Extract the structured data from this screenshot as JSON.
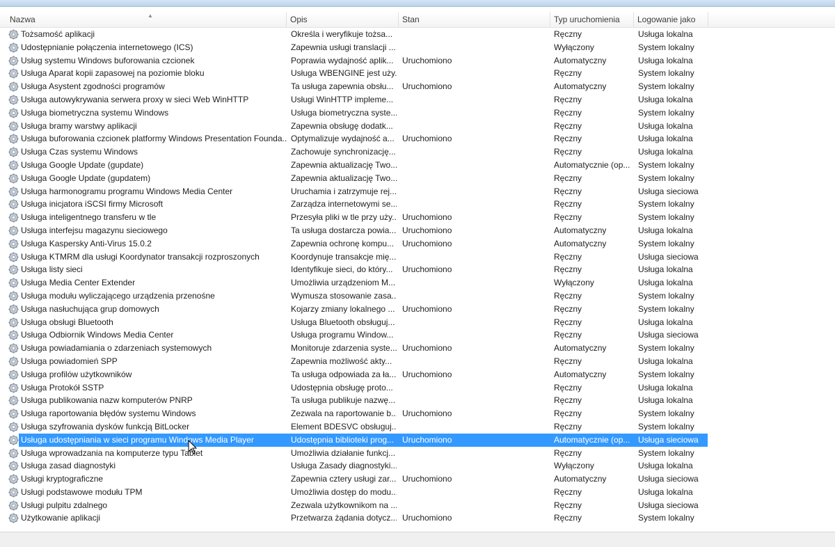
{
  "columns": {
    "name": "Nazwa",
    "desc": "Opis",
    "state": "Stan",
    "type": "Typ uruchomienia",
    "logon": "Logowanie jako"
  },
  "sort_indicator": "▲",
  "selected_index": 31,
  "rows": [
    {
      "name": "Tożsamość aplikacji",
      "desc": "Określa i weryfikuje tożsa...",
      "state": "",
      "type": "Ręczny",
      "logon": "Usługa lokalna"
    },
    {
      "name": "Udostępnianie połączenia internetowego (ICS)",
      "desc": "Zapewnia usługi translacji ...",
      "state": "",
      "type": "Wyłączony",
      "logon": "System lokalny"
    },
    {
      "name": "Usług systemu Windows buforowania czcionek",
      "desc": "Poprawia wydajność aplik...",
      "state": "Uruchomiono",
      "type": "Automatyczny",
      "logon": "Usługa lokalna"
    },
    {
      "name": "Usługa Aparat kopii zapasowej na poziomie bloku",
      "desc": "Usługa WBENGINE jest uży...",
      "state": "",
      "type": "Ręczny",
      "logon": "System lokalny"
    },
    {
      "name": "Usługa Asystent zgodności programów",
      "desc": "Ta usługa zapewnia obsłu...",
      "state": "Uruchomiono",
      "type": "Automatyczny",
      "logon": "System lokalny"
    },
    {
      "name": "Usługa autowykrywania serwera proxy w sieci Web WinHTTP",
      "desc": "Usługi WinHTTP impleme...",
      "state": "",
      "type": "Ręczny",
      "logon": "Usługa lokalna"
    },
    {
      "name": "Usługa biometryczna systemu Windows",
      "desc": "Usługa biometryczna syste...",
      "state": "",
      "type": "Ręczny",
      "logon": "System lokalny"
    },
    {
      "name": "Usługa bramy warstwy aplikacji",
      "desc": "Zapewnia obsługę dodatk...",
      "state": "",
      "type": "Ręczny",
      "logon": "Usługa lokalna"
    },
    {
      "name": "Usługa buforowania czcionek platformy Windows Presentation Founda...",
      "desc": "Optymalizuje wydajność a...",
      "state": "Uruchomiono",
      "type": "Ręczny",
      "logon": "Usługa lokalna"
    },
    {
      "name": "Usługa Czas systemu Windows",
      "desc": "Zachowuje synchronizację...",
      "state": "",
      "type": "Ręczny",
      "logon": "Usługa lokalna"
    },
    {
      "name": "Usługa Google Update (gupdate)",
      "desc": "Zapewnia aktualizację Two...",
      "state": "",
      "type": "Automatycznie (op...",
      "logon": "System lokalny"
    },
    {
      "name": "Usługa Google Update (gupdatem)",
      "desc": "Zapewnia aktualizację Two...",
      "state": "",
      "type": "Ręczny",
      "logon": "System lokalny"
    },
    {
      "name": "Usługa harmonogramu programu Windows Media Center",
      "desc": "Uruchamia i zatrzymuje rej...",
      "state": "",
      "type": "Ręczny",
      "logon": "Usługa sieciowa"
    },
    {
      "name": "Usługa inicjatora iSCSI firmy Microsoft",
      "desc": "Zarządza internetowymi se...",
      "state": "",
      "type": "Ręczny",
      "logon": "System lokalny"
    },
    {
      "name": "Usługa inteligentnego transferu w tle",
      "desc": "Przesyła pliki w tle przy uży...",
      "state": "Uruchomiono",
      "type": "Ręczny",
      "logon": "System lokalny"
    },
    {
      "name": "Usługa interfejsu magazynu sieciowego",
      "desc": "Ta usługa dostarcza powia...",
      "state": "Uruchomiono",
      "type": "Automatyczny",
      "logon": "Usługa lokalna"
    },
    {
      "name": "Usługa Kaspersky Anti-Virus 15.0.2",
      "desc": "Zapewnia ochronę kompu...",
      "state": "Uruchomiono",
      "type": "Automatyczny",
      "logon": "System lokalny"
    },
    {
      "name": "Usługa KTMRM dla usługi Koordynator transakcji rozproszonych",
      "desc": "Koordynuje transakcje mię...",
      "state": "",
      "type": "Ręczny",
      "logon": "Usługa sieciowa"
    },
    {
      "name": "Usługa listy sieci",
      "desc": "Identyfikuje sieci, do który...",
      "state": "Uruchomiono",
      "type": "Ręczny",
      "logon": "Usługa lokalna"
    },
    {
      "name": "Usługa Media Center Extender",
      "desc": "Umożliwia urządzeniom M...",
      "state": "",
      "type": "Wyłączony",
      "logon": "Usługa lokalna"
    },
    {
      "name": "Usługa modułu wyliczającego urządzenia przenośne",
      "desc": "Wymusza stosowanie zasa...",
      "state": "",
      "type": "Ręczny",
      "logon": "System lokalny"
    },
    {
      "name": "Usługa nasłuchująca grup domowych",
      "desc": "Kojarzy zmiany lokalnego ...",
      "state": "Uruchomiono",
      "type": "Ręczny",
      "logon": "System lokalny"
    },
    {
      "name": "Usługa obsługi Bluetooth",
      "desc": "Usługa Bluetooth obsługuj...",
      "state": "",
      "type": "Ręczny",
      "logon": "Usługa lokalna"
    },
    {
      "name": "Usługa Odbiornik Windows Media Center",
      "desc": "Usługa programu Window...",
      "state": "",
      "type": "Ręczny",
      "logon": "Usługa sieciowa"
    },
    {
      "name": "Usługa powiadamiania o zdarzeniach systemowych",
      "desc": "Monitoruje zdarzenia syste...",
      "state": "Uruchomiono",
      "type": "Automatyczny",
      "logon": "System lokalny"
    },
    {
      "name": "Usługa powiadomień SPP",
      "desc": "Zapewnia możliwość akty...",
      "state": "",
      "type": "Ręczny",
      "logon": "Usługa lokalna"
    },
    {
      "name": "Usługa profilów użytkowników",
      "desc": "Ta usługa odpowiada za ła...",
      "state": "Uruchomiono",
      "type": "Automatyczny",
      "logon": "System lokalny"
    },
    {
      "name": "Usługa Protokół SSTP",
      "desc": "Udostępnia obsługę proto...",
      "state": "",
      "type": "Ręczny",
      "logon": "Usługa lokalna"
    },
    {
      "name": "Usługa publikowania nazw komputerów PNRP",
      "desc": "Ta usługa publikuje nazwę...",
      "state": "",
      "type": "Ręczny",
      "logon": "Usługa lokalna"
    },
    {
      "name": "Usługa raportowania błędów systemu Windows",
      "desc": "Zezwala na raportowanie b...",
      "state": "Uruchomiono",
      "type": "Ręczny",
      "logon": "System lokalny"
    },
    {
      "name": "Usługa szyfrowania dysków funkcją BitLocker",
      "desc": "Element BDESVC obsługuj...",
      "state": "",
      "type": "Ręczny",
      "logon": "System lokalny"
    },
    {
      "name": "Usługa udostępniania w sieci programu Windows Media Player",
      "desc": "Udostępnia biblioteki prog...",
      "state": "Uruchomiono",
      "type": "Automatycznie (op...",
      "logon": "Usługa sieciowa"
    },
    {
      "name": "Usługa wprowadzania na komputerze typu Tablet",
      "desc": "Umożliwia działanie funkcj...",
      "state": "",
      "type": "Ręczny",
      "logon": "System lokalny"
    },
    {
      "name": "Usługa zasad diagnostyki",
      "desc": "Usługa Zasady diagnostyki...",
      "state": "",
      "type": "Wyłączony",
      "logon": "Usługa lokalna"
    },
    {
      "name": "Usługi kryptograficzne",
      "desc": "Zapewnia cztery usługi zar...",
      "state": "Uruchomiono",
      "type": "Automatyczny",
      "logon": "Usługa sieciowa"
    },
    {
      "name": "Usługi podstawowe modułu TPM",
      "desc": "Umożliwia dostęp do modu...",
      "state": "",
      "type": "Ręczny",
      "logon": "Usługa lokalna"
    },
    {
      "name": "Usługi pulpitu zdalnego",
      "desc": "Zezwala użytkownikom na ...",
      "state": "",
      "type": "Ręczny",
      "logon": "Usługa sieciowa"
    },
    {
      "name": "Użytkowanie aplikacji",
      "desc": "Przetwarza żądania dotycz...",
      "state": "Uruchomiono",
      "type": "Ręczny",
      "logon": "System lokalny"
    }
  ]
}
